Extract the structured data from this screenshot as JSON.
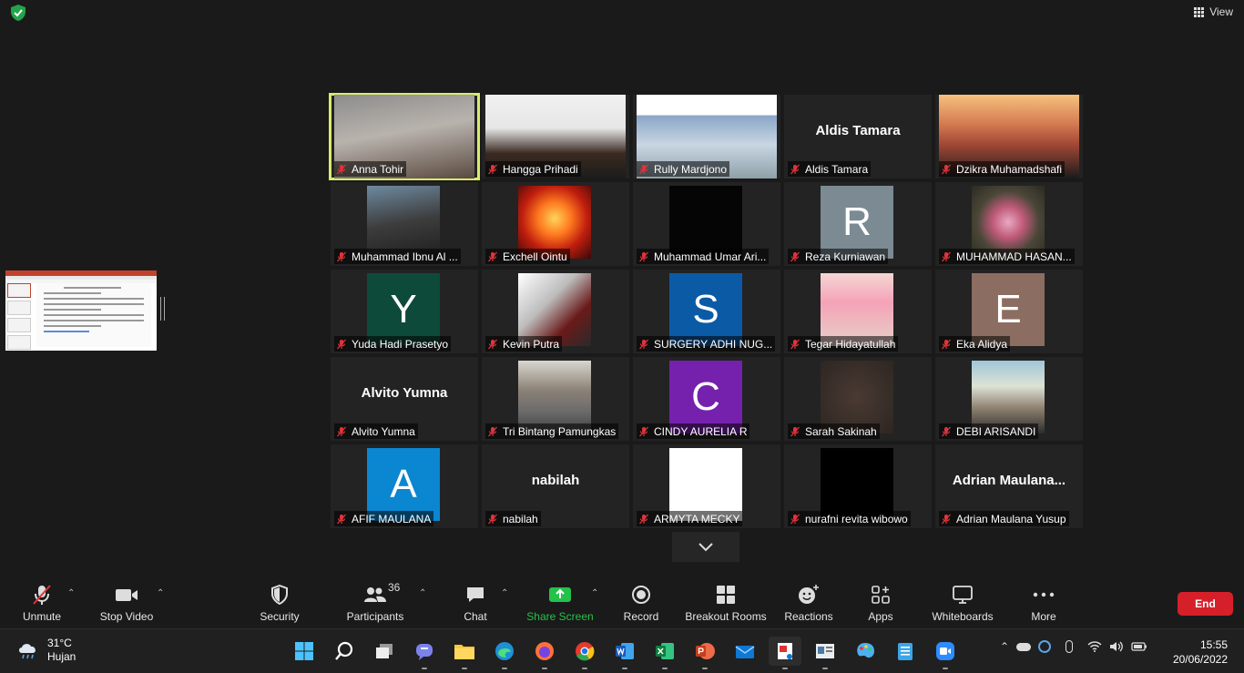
{
  "topbar": {
    "view_label": "View"
  },
  "participants": [
    {
      "name": "Anna Tohir",
      "type": "video",
      "active": true
    },
    {
      "name": "Hangga Prihadi",
      "type": "video"
    },
    {
      "name": "Rully Mardjono",
      "type": "video"
    },
    {
      "name": "Aldis Tamara",
      "type": "name",
      "display": "Aldis Tamara"
    },
    {
      "name": "Dzikra Muhamadshafi",
      "type": "video"
    },
    {
      "name": "Muhammad Ibnu Al ...",
      "type": "video"
    },
    {
      "name": "Exchell Ointu",
      "type": "image"
    },
    {
      "name": "Muhammad Umar Ari...",
      "type": "image"
    },
    {
      "name": "Reza Kurniawan",
      "type": "avatar",
      "letter": "R",
      "color": "#7b8a93"
    },
    {
      "name": "MUHAMMAD HASAN...",
      "type": "image"
    },
    {
      "name": "Yuda Hadi Prasetyo",
      "type": "avatar",
      "letter": "Y",
      "color": "#0e4a3a"
    },
    {
      "name": "Kevin Putra",
      "type": "image"
    },
    {
      "name": "SURGERY ADHI NUG...",
      "type": "avatar",
      "letter": "S",
      "color": "#0b5aa6"
    },
    {
      "name": "Tegar Hidayatullah",
      "type": "image"
    },
    {
      "name": "Eka Alidya",
      "type": "avatar",
      "letter": "E",
      "color": "#8c6d61"
    },
    {
      "name": "Alvito Yumna",
      "type": "name",
      "display": "Alvito Yumna"
    },
    {
      "name": "Tri Bintang Pamungkas",
      "type": "image"
    },
    {
      "name": "CINDY AURELIA R",
      "type": "avatar",
      "letter": "C",
      "color": "#7521ad"
    },
    {
      "name": "Sarah Sakinah",
      "type": "image"
    },
    {
      "name": "DEBI ARISANDI",
      "type": "image"
    },
    {
      "name": "AFIF MAULANA",
      "type": "avatar",
      "letter": "A",
      "color": "#0b86d1"
    },
    {
      "name": "nabilah",
      "type": "name",
      "display": "nabilah"
    },
    {
      "name": "ARMYTA MECKY",
      "type": "image"
    },
    {
      "name": "nurafni revita wibowo",
      "type": "image"
    },
    {
      "name": "Adrian Maulana Yusup",
      "type": "name",
      "display": "Adrian  Maulana..."
    }
  ],
  "toolbar": {
    "unmute": "Unmute",
    "stop_video": "Stop Video",
    "security": "Security",
    "participants": "Participants",
    "participants_count": "36",
    "chat": "Chat",
    "share_screen": "Share Screen",
    "record": "Record",
    "breakout": "Breakout Rooms",
    "reactions": "Reactions",
    "apps": "Apps",
    "whiteboards": "Whiteboards",
    "more": "More",
    "end": "End"
  },
  "taskbar": {
    "temp": "31°C",
    "weather": "Hujan",
    "time": "15:55",
    "date": "20/06/2022"
  },
  "colors": {
    "active_border": "#d9eb6c",
    "end_red": "#d5202a",
    "share_green": "#24c24a"
  }
}
